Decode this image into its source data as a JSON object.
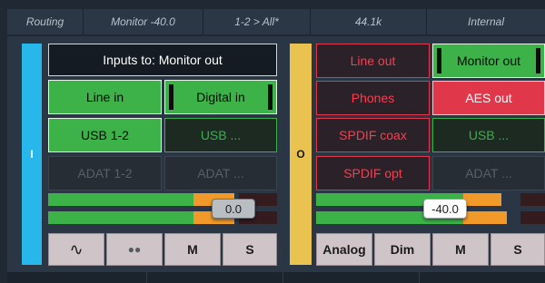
{
  "topbar": {
    "routing": "Routing",
    "monitor": "Monitor -40.0",
    "selection": "1-2 > All*",
    "rate": "44.1k",
    "clock": "Internal"
  },
  "input_side": {
    "strip_label": "I",
    "header": "Inputs to: Monitor out",
    "sources": [
      {
        "label": "Line in",
        "state": "selected"
      },
      {
        "label": "Digital in",
        "state": "selected"
      },
      {
        "label": "USB 1-2",
        "state": "selected"
      },
      {
        "label": "USB ...",
        "state": "available"
      },
      {
        "label": "ADAT 1-2",
        "state": "disabled"
      },
      {
        "label": "ADAT ...",
        "state": "disabled"
      }
    ],
    "gain_value": "0.0",
    "buttons": [
      "∿",
      "●●",
      "M",
      "S"
    ]
  },
  "output_side": {
    "strip_label": "O",
    "outputs": [
      {
        "label": "Line out",
        "state": "available"
      },
      {
        "label": "Monitor out",
        "state": "selected"
      },
      {
        "label": "Phones",
        "state": "available"
      },
      {
        "label": "AES out",
        "state": "active"
      },
      {
        "label": "SPDIF coax",
        "state": "available"
      },
      {
        "label": "USB ...",
        "state": "available"
      },
      {
        "label": "SPDIF opt",
        "state": "available"
      },
      {
        "label": "ADAT ...",
        "state": "disabled"
      }
    ],
    "volume_value": "-40.0",
    "buttons": [
      "Analog",
      "Dim",
      "M",
      "S"
    ]
  },
  "colors": {
    "input_strip": "#27b7ea",
    "output_strip": "#e9c24f",
    "selected_green": "#3cb249",
    "output_red": "#e0384a",
    "meter_orange": "#f19a2a"
  }
}
